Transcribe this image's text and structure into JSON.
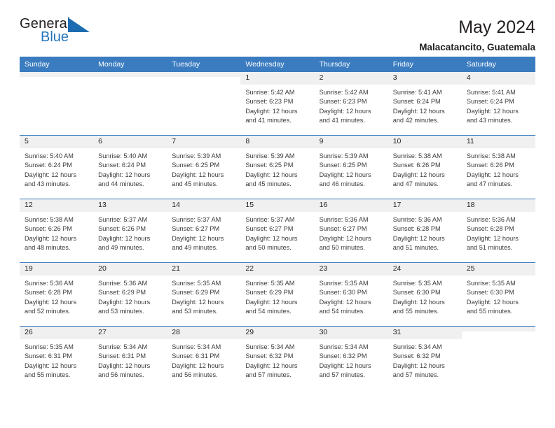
{
  "brand": {
    "name_part1": "General",
    "name_part2": "Blue",
    "accent_color": "#2476bc",
    "triangle_color": "#1b6cb0",
    "logo_icon": "triangle-icon"
  },
  "header": {
    "title": "May 2024",
    "subtitle": "Malacatancito, Guatemala"
  },
  "theme": {
    "header_blue": "#3b7cc0",
    "daynum_band": "#f0f0f0",
    "text": "#231f20"
  },
  "weekdays": [
    "Sunday",
    "Monday",
    "Tuesday",
    "Wednesday",
    "Thursday",
    "Friday",
    "Saturday"
  ],
  "labels": {
    "sunrise_prefix": "Sunrise:",
    "sunset_prefix": "Sunset:",
    "daylight_prefix": "Daylight:"
  },
  "weeks": [
    [
      {
        "day": "",
        "empty": true
      },
      {
        "day": "",
        "empty": true
      },
      {
        "day": "",
        "empty": true
      },
      {
        "day": "1",
        "sunrise": "Sunrise: 5:42 AM",
        "sunset": "Sunset: 6:23 PM",
        "daylight_line1": "Daylight: 12 hours",
        "daylight_line2": "and 41 minutes."
      },
      {
        "day": "2",
        "sunrise": "Sunrise: 5:42 AM",
        "sunset": "Sunset: 6:23 PM",
        "daylight_line1": "Daylight: 12 hours",
        "daylight_line2": "and 41 minutes."
      },
      {
        "day": "3",
        "sunrise": "Sunrise: 5:41 AM",
        "sunset": "Sunset: 6:24 PM",
        "daylight_line1": "Daylight: 12 hours",
        "daylight_line2": "and 42 minutes."
      },
      {
        "day": "4",
        "sunrise": "Sunrise: 5:41 AM",
        "sunset": "Sunset: 6:24 PM",
        "daylight_line1": "Daylight: 12 hours",
        "daylight_line2": "and 43 minutes."
      }
    ],
    [
      {
        "day": "5",
        "sunrise": "Sunrise: 5:40 AM",
        "sunset": "Sunset: 6:24 PM",
        "daylight_line1": "Daylight: 12 hours",
        "daylight_line2": "and 43 minutes."
      },
      {
        "day": "6",
        "sunrise": "Sunrise: 5:40 AM",
        "sunset": "Sunset: 6:24 PM",
        "daylight_line1": "Daylight: 12 hours",
        "daylight_line2": "and 44 minutes."
      },
      {
        "day": "7",
        "sunrise": "Sunrise: 5:39 AM",
        "sunset": "Sunset: 6:25 PM",
        "daylight_line1": "Daylight: 12 hours",
        "daylight_line2": "and 45 minutes."
      },
      {
        "day": "8",
        "sunrise": "Sunrise: 5:39 AM",
        "sunset": "Sunset: 6:25 PM",
        "daylight_line1": "Daylight: 12 hours",
        "daylight_line2": "and 45 minutes."
      },
      {
        "day": "9",
        "sunrise": "Sunrise: 5:39 AM",
        "sunset": "Sunset: 6:25 PM",
        "daylight_line1": "Daylight: 12 hours",
        "daylight_line2": "and 46 minutes."
      },
      {
        "day": "10",
        "sunrise": "Sunrise: 5:38 AM",
        "sunset": "Sunset: 6:26 PM",
        "daylight_line1": "Daylight: 12 hours",
        "daylight_line2": "and 47 minutes."
      },
      {
        "day": "11",
        "sunrise": "Sunrise: 5:38 AM",
        "sunset": "Sunset: 6:26 PM",
        "daylight_line1": "Daylight: 12 hours",
        "daylight_line2": "and 47 minutes."
      }
    ],
    [
      {
        "day": "12",
        "sunrise": "Sunrise: 5:38 AM",
        "sunset": "Sunset: 6:26 PM",
        "daylight_line1": "Daylight: 12 hours",
        "daylight_line2": "and 48 minutes."
      },
      {
        "day": "13",
        "sunrise": "Sunrise: 5:37 AM",
        "sunset": "Sunset: 6:26 PM",
        "daylight_line1": "Daylight: 12 hours",
        "daylight_line2": "and 49 minutes."
      },
      {
        "day": "14",
        "sunrise": "Sunrise: 5:37 AM",
        "sunset": "Sunset: 6:27 PM",
        "daylight_line1": "Daylight: 12 hours",
        "daylight_line2": "and 49 minutes."
      },
      {
        "day": "15",
        "sunrise": "Sunrise: 5:37 AM",
        "sunset": "Sunset: 6:27 PM",
        "daylight_line1": "Daylight: 12 hours",
        "daylight_line2": "and 50 minutes."
      },
      {
        "day": "16",
        "sunrise": "Sunrise: 5:36 AM",
        "sunset": "Sunset: 6:27 PM",
        "daylight_line1": "Daylight: 12 hours",
        "daylight_line2": "and 50 minutes."
      },
      {
        "day": "17",
        "sunrise": "Sunrise: 5:36 AM",
        "sunset": "Sunset: 6:28 PM",
        "daylight_line1": "Daylight: 12 hours",
        "daylight_line2": "and 51 minutes."
      },
      {
        "day": "18",
        "sunrise": "Sunrise: 5:36 AM",
        "sunset": "Sunset: 6:28 PM",
        "daylight_line1": "Daylight: 12 hours",
        "daylight_line2": "and 51 minutes."
      }
    ],
    [
      {
        "day": "19",
        "sunrise": "Sunrise: 5:36 AM",
        "sunset": "Sunset: 6:28 PM",
        "daylight_line1": "Daylight: 12 hours",
        "daylight_line2": "and 52 minutes."
      },
      {
        "day": "20",
        "sunrise": "Sunrise: 5:36 AM",
        "sunset": "Sunset: 6:29 PM",
        "daylight_line1": "Daylight: 12 hours",
        "daylight_line2": "and 53 minutes."
      },
      {
        "day": "21",
        "sunrise": "Sunrise: 5:35 AM",
        "sunset": "Sunset: 6:29 PM",
        "daylight_line1": "Daylight: 12 hours",
        "daylight_line2": "and 53 minutes."
      },
      {
        "day": "22",
        "sunrise": "Sunrise: 5:35 AM",
        "sunset": "Sunset: 6:29 PM",
        "daylight_line1": "Daylight: 12 hours",
        "daylight_line2": "and 54 minutes."
      },
      {
        "day": "23",
        "sunrise": "Sunrise: 5:35 AM",
        "sunset": "Sunset: 6:30 PM",
        "daylight_line1": "Daylight: 12 hours",
        "daylight_line2": "and 54 minutes."
      },
      {
        "day": "24",
        "sunrise": "Sunrise: 5:35 AM",
        "sunset": "Sunset: 6:30 PM",
        "daylight_line1": "Daylight: 12 hours",
        "daylight_line2": "and 55 minutes."
      },
      {
        "day": "25",
        "sunrise": "Sunrise: 5:35 AM",
        "sunset": "Sunset: 6:30 PM",
        "daylight_line1": "Daylight: 12 hours",
        "daylight_line2": "and 55 minutes."
      }
    ],
    [
      {
        "day": "26",
        "sunrise": "Sunrise: 5:35 AM",
        "sunset": "Sunset: 6:31 PM",
        "daylight_line1": "Daylight: 12 hours",
        "daylight_line2": "and 55 minutes."
      },
      {
        "day": "27",
        "sunrise": "Sunrise: 5:34 AM",
        "sunset": "Sunset: 6:31 PM",
        "daylight_line1": "Daylight: 12 hours",
        "daylight_line2": "and 56 minutes."
      },
      {
        "day": "28",
        "sunrise": "Sunrise: 5:34 AM",
        "sunset": "Sunset: 6:31 PM",
        "daylight_line1": "Daylight: 12 hours",
        "daylight_line2": "and 56 minutes."
      },
      {
        "day": "29",
        "sunrise": "Sunrise: 5:34 AM",
        "sunset": "Sunset: 6:32 PM",
        "daylight_line1": "Daylight: 12 hours",
        "daylight_line2": "and 57 minutes."
      },
      {
        "day": "30",
        "sunrise": "Sunrise: 5:34 AM",
        "sunset": "Sunset: 6:32 PM",
        "daylight_line1": "Daylight: 12 hours",
        "daylight_line2": "and 57 minutes."
      },
      {
        "day": "31",
        "sunrise": "Sunrise: 5:34 AM",
        "sunset": "Sunset: 6:32 PM",
        "daylight_line1": "Daylight: 12 hours",
        "daylight_line2": "and 57 minutes."
      },
      {
        "day": "",
        "empty": true
      }
    ]
  ]
}
